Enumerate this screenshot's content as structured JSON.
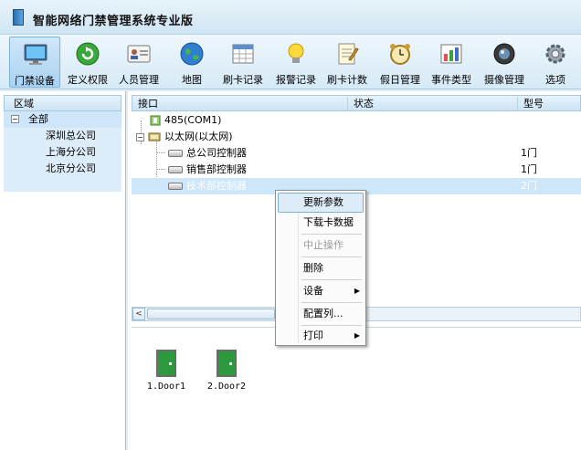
{
  "window": {
    "title": "智能网络门禁管理系统专业版"
  },
  "toolbar": {
    "buttons": [
      {
        "label": "门禁设备",
        "icon": "monitor-icon"
      },
      {
        "label": "定义权限",
        "icon": "refresh-icon"
      },
      {
        "label": "人员管理",
        "icon": "person-card-icon"
      },
      {
        "label": "地图",
        "icon": "globe-icon"
      },
      {
        "label": "刷卡记录",
        "icon": "calendar-grid-icon"
      },
      {
        "label": "报警记录",
        "icon": "bulb-icon"
      },
      {
        "label": "刷卡计数",
        "icon": "notepad-icon"
      },
      {
        "label": "假日管理",
        "icon": "alarm-clock-icon"
      },
      {
        "label": "事件类型",
        "icon": "chart-icon"
      },
      {
        "label": "摄像管理",
        "icon": "camera-icon"
      },
      {
        "label": "选项",
        "icon": "gear-icon"
      }
    ]
  },
  "region": {
    "header": "区域",
    "root": "全部",
    "root_toggle": "−",
    "children": [
      "深圳总公司",
      "上海分公司",
      "北京分公司"
    ]
  },
  "grid": {
    "columns": [
      "接口",
      "状态",
      "型号"
    ],
    "rows": [
      {
        "name": "485(COM1)",
        "status": "",
        "model": ""
      },
      {
        "name": "以太网(以太网)",
        "status": "",
        "model": ""
      },
      {
        "name": "总公司控制器",
        "status": "",
        "model": "1门"
      },
      {
        "name": "销售部控制器",
        "status": "",
        "model": "1门"
      },
      {
        "name": "技术部控制器",
        "status": "",
        "model": "2门"
      }
    ]
  },
  "scrollbar": {
    "left_arrow": "<"
  },
  "doors": [
    {
      "label": "1.Door1"
    },
    {
      "label": "2.Door2"
    }
  ],
  "context_menu": {
    "items": [
      {
        "label": "更新参数"
      },
      {
        "label": "下载卡数据"
      },
      {
        "label": "中止操作"
      },
      {
        "label": "删除"
      },
      {
        "label": "设备"
      },
      {
        "label": "配置列..."
      },
      {
        "label": "打印"
      }
    ],
    "submenu_arrow": "▶"
  }
}
